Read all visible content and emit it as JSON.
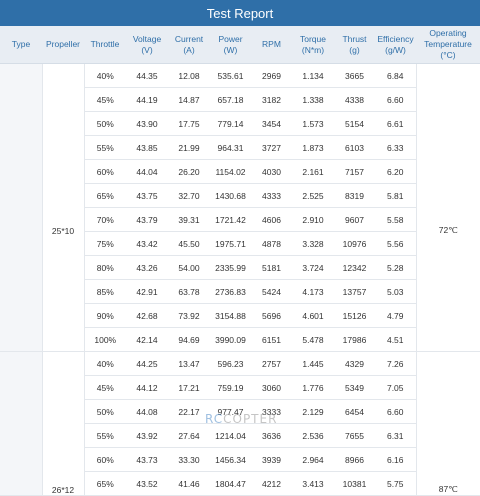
{
  "title": "Test Report",
  "headers": {
    "type": "Type",
    "propeller": "Propeller",
    "throttle": "Throttle",
    "voltage_l1": "Voltage",
    "voltage_l2": "(V)",
    "current_l1": "Current",
    "current_l2": "(A)",
    "power_l1": "Power",
    "power_l2": "(W)",
    "rpm": "RPM",
    "torque_l1": "Torque",
    "torque_l2": "(N*m)",
    "thrust_l1": "Thrust",
    "thrust_l2": "(g)",
    "efficiency_l1": "Efficiency",
    "efficiency_l2": "(g/W)",
    "temp_l1": "Operating",
    "temp_l2": "Temperature",
    "temp_l3": "(°C)"
  },
  "groups": [
    {
      "propeller": "25*10",
      "temperature": "72℃",
      "rows": [
        [
          "40%",
          "44.35",
          "12.08",
          "535.61",
          "2969",
          "1.134",
          "3665",
          "6.84"
        ],
        [
          "45%",
          "44.19",
          "14.87",
          "657.18",
          "3182",
          "1.338",
          "4338",
          "6.60"
        ],
        [
          "50%",
          "43.90",
          "17.75",
          "779.14",
          "3454",
          "1.573",
          "5154",
          "6.61"
        ],
        [
          "55%",
          "43.85",
          "21.99",
          "964.31",
          "3727",
          "1.873",
          "6103",
          "6.33"
        ],
        [
          "60%",
          "44.04",
          "26.20",
          "1154.02",
          "4030",
          "2.161",
          "7157",
          "6.20"
        ],
        [
          "65%",
          "43.75",
          "32.70",
          "1430.68",
          "4333",
          "2.525",
          "8319",
          "5.81"
        ],
        [
          "70%",
          "43.79",
          "39.31",
          "1721.42",
          "4606",
          "2.910",
          "9607",
          "5.58"
        ],
        [
          "75%",
          "43.42",
          "45.50",
          "1975.71",
          "4878",
          "3.328",
          "10976",
          "5.56"
        ],
        [
          "80%",
          "43.26",
          "54.00",
          "2335.99",
          "5181",
          "3.724",
          "12342",
          "5.28"
        ],
        [
          "85%",
          "42.91",
          "63.78",
          "2736.83",
          "5424",
          "4.173",
          "13757",
          "5.03"
        ],
        [
          "90%",
          "42.68",
          "73.92",
          "3154.88",
          "5696",
          "4.601",
          "15126",
          "4.79"
        ],
        [
          "100%",
          "42.14",
          "94.69",
          "3990.09",
          "6151",
          "5.478",
          "17986",
          "4.51"
        ]
      ]
    },
    {
      "propeller": "26*12",
      "temperature": "87℃",
      "rows": [
        [
          "40%",
          "44.25",
          "13.47",
          "596.23",
          "2757",
          "1.445",
          "4329",
          "7.26"
        ],
        [
          "45%",
          "44.12",
          "17.21",
          "759.19",
          "3060",
          "1.776",
          "5349",
          "7.05"
        ],
        [
          "50%",
          "44.08",
          "22.17",
          "977.47",
          "3333",
          "2.129",
          "6454",
          "6.60"
        ],
        [
          "55%",
          "43.92",
          "27.64",
          "1214.04",
          "3636",
          "2.536",
          "7655",
          "6.31"
        ],
        [
          "60%",
          "43.73",
          "33.30",
          "1456.34",
          "3939",
          "2.964",
          "8966",
          "6.16"
        ],
        [
          "65%",
          "43.52",
          "41.46",
          "1804.47",
          "4212",
          "3.413",
          "10381",
          "5.75"
        ]
      ]
    }
  ],
  "watermark": {
    "part_a": "RC",
    "part_b": "COPTER"
  }
}
